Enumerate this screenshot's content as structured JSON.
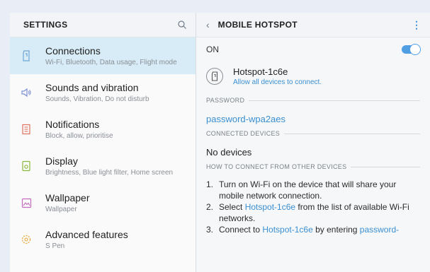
{
  "settings": {
    "title": "SETTINGS",
    "items": [
      {
        "title": "Connections",
        "subtitle": "Wi-Fi, Bluetooth, Data usage, Flight mode"
      },
      {
        "title": "Sounds and vibration",
        "subtitle": "Sounds, Vibration, Do not disturb"
      },
      {
        "title": "Notifications",
        "subtitle": "Block, allow, prioritise"
      },
      {
        "title": "Display",
        "subtitle": "Brightness, Blue light filter, Home screen"
      },
      {
        "title": "Wallpaper",
        "subtitle": "Wallpaper"
      },
      {
        "title": "Advanced features",
        "subtitle": "S Pen"
      }
    ]
  },
  "hotspot_page": {
    "title": "MOBILE HOTSPOT",
    "on_label": "ON",
    "toggle_on": true,
    "hotspot_name": "Hotspot-1c6e",
    "hotspot_sub": "Allow all devices to connect.",
    "password_section": "PASSWORD",
    "password": "password-wpa2aes",
    "connected_section": "CONNECTED DEVICES",
    "connected_value": "No devices",
    "howto_section": "HOW TO CONNECT FROM OTHER DEVICES",
    "steps": [
      {
        "num": "1.",
        "text": "Turn on Wi-Fi on the device that will share your mobile network connection."
      },
      {
        "num": "2.",
        "pre": "Select ",
        "link": "Hotspot-1c6e",
        "post": " from the list of available Wi-Fi networks."
      },
      {
        "num": "3.",
        "pre": "Connect to ",
        "link": "Hotspot-1c6e",
        "mid": " by entering ",
        "link2": "password-"
      }
    ]
  },
  "colors": {
    "accent": "#3a8fd1",
    "active_row": "#d8ecf7"
  },
  "icons": [
    "search-icon",
    "connections-icon",
    "sound-icon",
    "notifications-icon",
    "display-icon",
    "wallpaper-icon",
    "advanced-features-icon",
    "back-icon",
    "more-options-icon",
    "hotspot-device-icon"
  ]
}
